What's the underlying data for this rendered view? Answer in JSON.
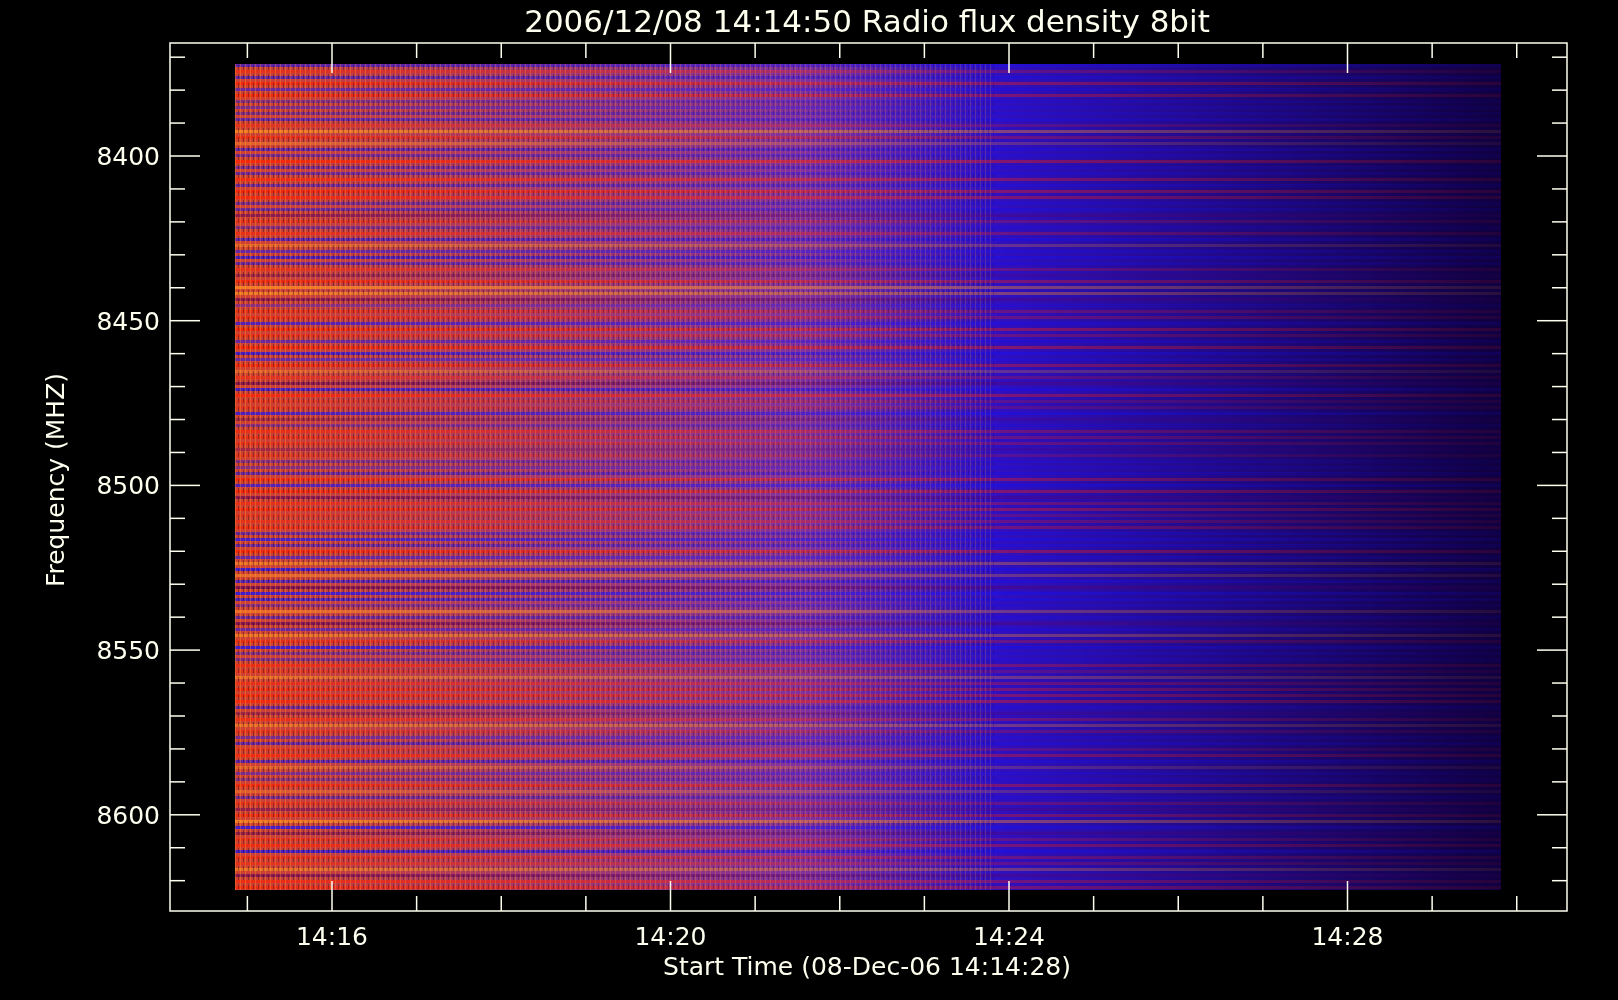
{
  "title": "2006/12/08 14:14:50 Radio flux density 8bit",
  "y_axis": {
    "label": "Frequency (MHZ)",
    "ticks": [
      "8400",
      "8450",
      "8500",
      "8550",
      "8600"
    ]
  },
  "x_axis": {
    "label": "Start Time (08-Dec-06 14:14:28)",
    "ticks": [
      "14:16",
      "14:20",
      "14:24",
      "14:28"
    ]
  }
}
